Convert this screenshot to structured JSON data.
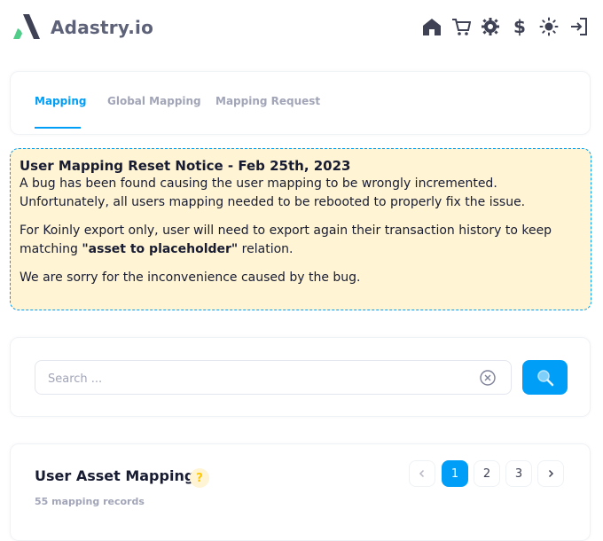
{
  "brand": {
    "name": "Adastry.io"
  },
  "header": {
    "icons": [
      "home-icon",
      "cart-icon",
      "gear-icon",
      "dollar-icon",
      "sun-icon",
      "sign-out-icon"
    ],
    "dollar_symbol": "$"
  },
  "tabs": [
    {
      "label": "Mapping",
      "active": true
    },
    {
      "label": "Global Mapping",
      "active": false
    },
    {
      "label": "Mapping Request",
      "active": false
    }
  ],
  "notice": {
    "title": "User Mapping Reset Notice - Feb 25th, 2023",
    "p1": "A bug has been found causing the user mapping to be wrongly incremented. Unfortunately, all users mapping needed to be rebooted to properly fix the issue.",
    "p2_before": "For Koinly export only, user will need to export again their transaction history to keep matching ",
    "p2_bold": "\"asset to placeholder\"",
    "p2_after": " relation.",
    "p3": "We are sorry for the inconvenience caused by the bug."
  },
  "search": {
    "placeholder": "Search ...",
    "value": ""
  },
  "asset_mapping": {
    "title": "User Asset Mapping",
    "help_symbol": "?",
    "records": "55 mapping records",
    "pagination": {
      "pages": [
        "1",
        "2",
        "3"
      ],
      "current": "1"
    }
  },
  "colors": {
    "primary": "#009ef7",
    "notice_bg": "#fff4d3",
    "logo_dark": "#3f4254",
    "logo_green": "#50cd89"
  }
}
